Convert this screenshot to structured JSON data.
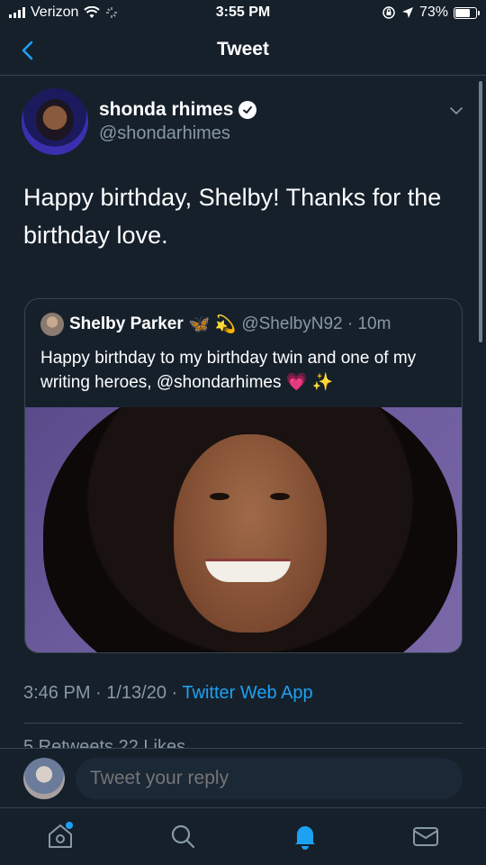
{
  "status_bar": {
    "carrier": "Verizon",
    "time": "3:55 PM",
    "battery": "73%",
    "battery_level": 0.73
  },
  "nav": {
    "title": "Tweet"
  },
  "tweet": {
    "author_name": "shonda rhimes",
    "author_handle": "@shondarhimes",
    "text": "Happy birthday, Shelby! Thanks for the birthday love.",
    "timestamp": "3:46 PM · 1/13/20 · ",
    "source": "Twitter Web App",
    "stats": "5 Retweets  22 Likes"
  },
  "quote": {
    "name": "Shelby Parker",
    "emojis": "🦋 💫",
    "handle_time": "@ShelbyN92 · 10m",
    "text": "Happy birthday to my birthday twin and one of my writing heroes, @shondarhimes 💗 ✨"
  },
  "reply": {
    "placeholder": "Tweet your reply"
  },
  "colors": {
    "background": "#15202b",
    "accent": "#1da1f2",
    "secondary_text": "#8899a6"
  }
}
